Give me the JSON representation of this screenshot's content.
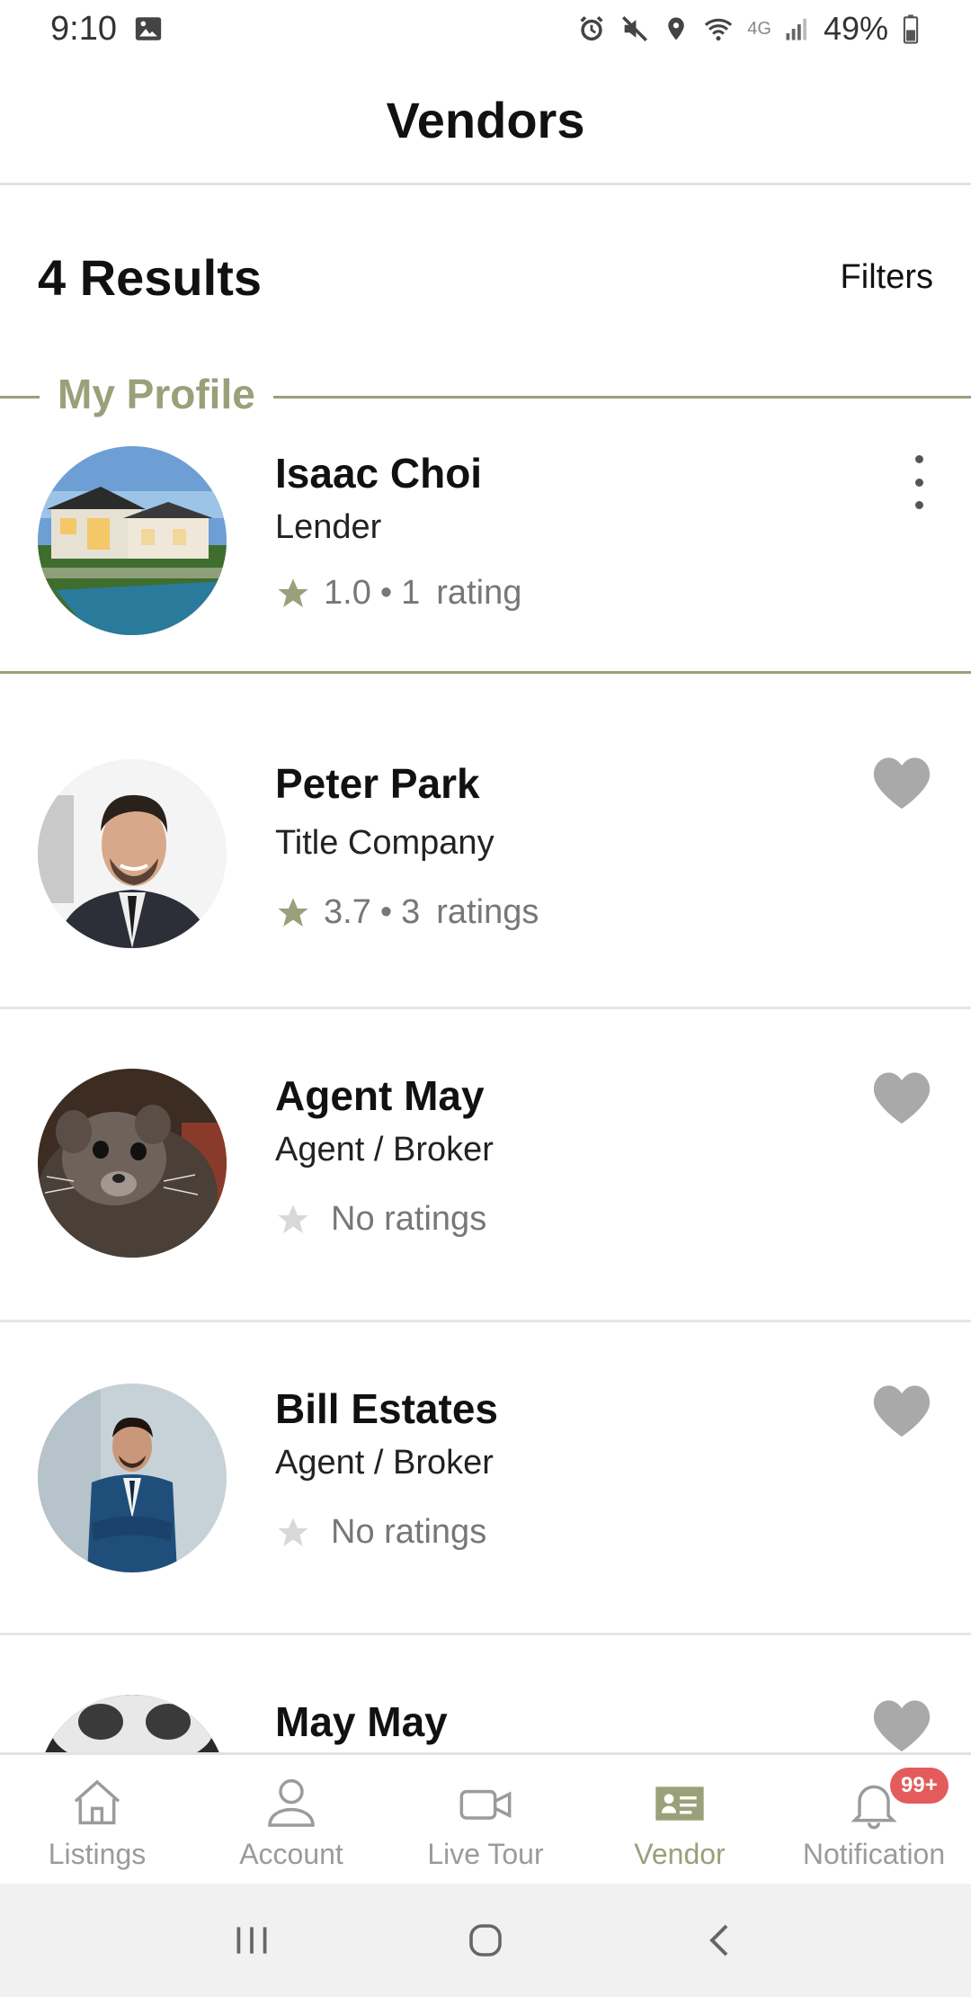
{
  "status_bar": {
    "time": "9:10",
    "battery": "49%",
    "network": "4G"
  },
  "header": {
    "title": "Vendors"
  },
  "results": {
    "count_label": "4 Results",
    "filters_label": "Filters"
  },
  "my_profile": {
    "section_label": "My Profile",
    "vendor": {
      "name": "Isaac Choi",
      "role": "Lender",
      "rating": "1.0",
      "rating_count": "1",
      "rating_word": "rating",
      "avatar": "house-photo"
    }
  },
  "vendors": [
    {
      "name": "Peter Park",
      "role": "Title Company",
      "rating": "3.7",
      "rating_count": "3",
      "rating_word": "ratings",
      "avatar": "man-in-suit-photo"
    },
    {
      "name": "Agent May",
      "role": "Agent / Broker",
      "no_ratings_label": "No ratings",
      "avatar": "animal-photo"
    },
    {
      "name": "Bill Estates",
      "role": "Agent / Broker",
      "no_ratings_label": "No ratings",
      "avatar": "man-in-blue-suit-photo"
    },
    {
      "name": "May May",
      "avatar": "animal-photo-2"
    }
  ],
  "bottom_nav": {
    "items": [
      {
        "label": "Listings",
        "icon": "home-icon"
      },
      {
        "label": "Account",
        "icon": "person-icon"
      },
      {
        "label": "Live Tour",
        "icon": "video-camera-icon"
      },
      {
        "label": "Vendor",
        "icon": "id-card-icon",
        "active": true
      },
      {
        "label": "Notification",
        "icon": "bell-icon",
        "badge": "99+"
      }
    ]
  },
  "colors": {
    "accent": "#9aa079",
    "star_filled": "#9aa079",
    "star_empty": "#d8d8d8",
    "heart": "#a9a9a9",
    "badge": "#e45b5b"
  }
}
